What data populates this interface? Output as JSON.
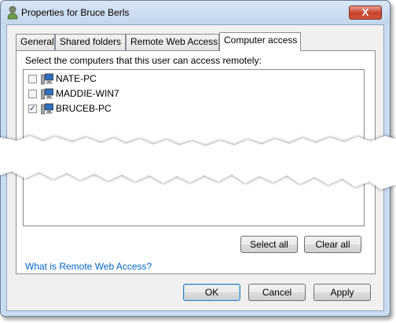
{
  "window": {
    "title": "Properties for Bruce Berls",
    "close_glyph": "X"
  },
  "tabs": [
    {
      "label": "General",
      "active": false
    },
    {
      "label": "Shared folders",
      "active": false
    },
    {
      "label": "Remote Web Access",
      "active": false
    },
    {
      "label": "Computer access",
      "active": true
    }
  ],
  "panel": {
    "instruction": "Select the computers that this user can access remotely:",
    "computers": [
      {
        "name": "NATE-PC",
        "checked": false,
        "check_glyph": ""
      },
      {
        "name": "MADDIE-WIN7",
        "checked": false,
        "check_glyph": ""
      },
      {
        "name": "BRUCEB-PC",
        "checked": true,
        "check_glyph": "✓"
      }
    ],
    "select_all_label": "Select all",
    "clear_all_label": "Clear all"
  },
  "help_link": "What is Remote Web Access?",
  "footer": {
    "ok_label": "OK",
    "cancel_label": "Cancel",
    "apply_label": "Apply"
  },
  "colors": {
    "window_frame": "#c9dbef",
    "close_button": "#c7402a",
    "link": "#0066cc"
  }
}
